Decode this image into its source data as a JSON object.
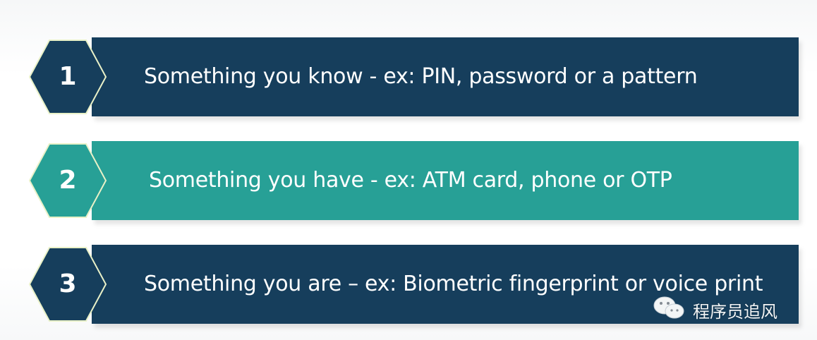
{
  "colors": {
    "dark": "#163e5c",
    "teal": "#27a096",
    "hex_outline": "#e9f1c8",
    "text": "#ffffff"
  },
  "items": [
    {
      "number": "1",
      "text": "Something you know - ex: PIN, password or a pattern"
    },
    {
      "number": "2",
      "text": "Something you have - ex: ATM card, phone or OTP"
    },
    {
      "number": "3",
      "text": "Something you are – ex: Biometric fingerprint or voice print"
    }
  ],
  "watermark": {
    "icon": "wechat-icon",
    "text": "程序员追风"
  }
}
